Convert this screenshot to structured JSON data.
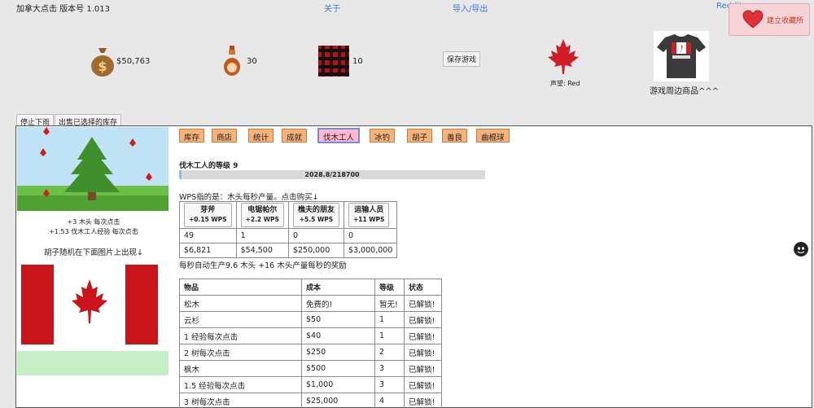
{
  "app": {
    "title": "加拿大点击 版本号 1.013",
    "links": {
      "about": "关于",
      "import_export": "导入/导出",
      "reddit": "Reddit"
    },
    "bookmark_label": "建立收藏所"
  },
  "stats": {
    "money": "$50,763",
    "syrup": "30",
    "flannel": "10"
  },
  "save_label": "保存游戏",
  "reputation": "声望: Red",
  "merch_label": "游戏周边商品^^^",
  "buttons": {
    "stop": "停止下雨",
    "sell": "出售已选择的库存"
  },
  "left": {
    "line1": "+3 木头 每次点击",
    "line2": "+1.53 伐木工人经验 每次点击",
    "beard_note": "胡子随机在下面图片上出现↓"
  },
  "tabs": [
    {
      "label": "库存"
    },
    {
      "label": "商店"
    },
    {
      "label": "统计"
    },
    {
      "label": "成就"
    },
    {
      "label": "伐木工人",
      "active": true
    },
    {
      "label": "冰钓"
    },
    {
      "label": "胡子"
    },
    {
      "label": "善良"
    },
    {
      "label": "曲棍球"
    }
  ],
  "lumberjack": {
    "level_title": "伐木工人的等级 9",
    "xp_text": "2028.8/218700",
    "xp_fraction": 0.0093,
    "wps_label": "WPS指的是：木头每秒产量。点击购买↓",
    "buyables": [
      {
        "name": "芽斧",
        "rate": "+0.15 WPS",
        "owned": "49",
        "price": "$6,821"
      },
      {
        "name": "电锯帕尔",
        "rate": "+2.2 WPS",
        "owned": "1",
        "price": "$54,500"
      },
      {
        "name": "樵夫的朋友",
        "rate": "+5.5 WPS",
        "owned": "0",
        "price": "$250,000"
      },
      {
        "name": "运输人员",
        "rate": "+11 WPS",
        "owned": "0",
        "price": "$3,000,000"
      }
    ],
    "auto_text": "每秒自动生产9.6 木头 +16 木头产量每秒的奖励"
  },
  "items_table": {
    "headers": [
      "物品",
      "成本",
      "等级",
      "状态"
    ],
    "rows": [
      [
        "松木",
        "免费的!",
        "暂无!",
        "已解锁!"
      ],
      [
        "云杉",
        "$50",
        "1",
        "已解锁!"
      ],
      [
        "1 经验每次点击",
        "$40",
        "1",
        "已解锁!"
      ],
      [
        "2 树每次点击",
        "$250",
        "2",
        "已解锁!"
      ],
      [
        "枫木",
        "$500",
        "3",
        "已解锁!"
      ],
      [
        "1.5 经验每次点击",
        "$1,000",
        "3",
        "已解锁!"
      ],
      [
        "3 树每次点击",
        "$25,000",
        "4",
        "已解锁!"
      ]
    ]
  },
  "colors": {
    "tab_bg": "#f7b27a",
    "tab_active_bg": "#ffb7d0",
    "tab_active_border": "#6c8ce6",
    "link": "#3a7bd5",
    "bookmark_bg": "#f6d3d6",
    "green_bar": "#c6efc6"
  }
}
